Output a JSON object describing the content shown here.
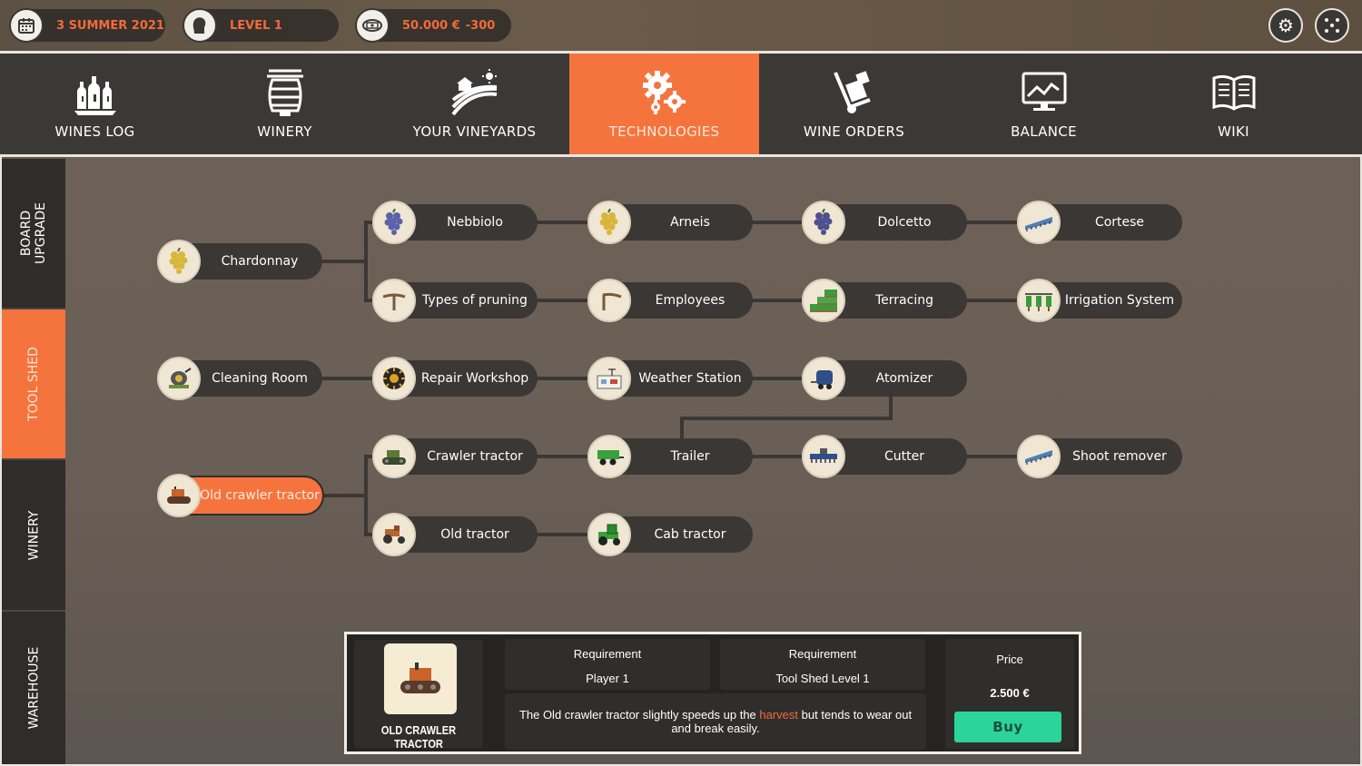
{
  "status_bar": {
    "date": "3 SUMMER 2021",
    "level": "LEVEL 1",
    "money": "50.000 €",
    "money_change": "-300",
    "icons": [
      "calendar-icon",
      "head-icon",
      "money-icon",
      "settings-icon",
      "fullscreen-icon"
    ]
  },
  "nav": {
    "items": [
      {
        "label": "WINES LOG",
        "icon": "bottles-icon"
      },
      {
        "label": "WINERY",
        "icon": "barrel-icon"
      },
      {
        "label": "YOUR VINEYARDS",
        "icon": "vineyard-icon"
      },
      {
        "label": "TECHNOLOGIES",
        "icon": "gears-icon",
        "active": true
      },
      {
        "label": "WINE ORDERS",
        "icon": "handtruck-icon"
      },
      {
        "label": "BALANCE",
        "icon": "monitor-chart-icon"
      },
      {
        "label": "WIKI",
        "icon": "book-icon"
      }
    ]
  },
  "side_tabs": [
    {
      "label_line1": "BOARD",
      "label_line2": "UPGRADE"
    },
    {
      "label_line1": "TOOL SHED",
      "label_line2": "",
      "active": true
    },
    {
      "label_line1": "WINERY",
      "label_line2": ""
    },
    {
      "label_line1": "WAREHOUSE",
      "label_line2": ""
    }
  ],
  "tree": {
    "nodes": {
      "chardonnay": {
        "label": "Chardonnay",
        "icon": "grape-white-icon"
      },
      "nebbiolo": {
        "label": "Nebbiolo",
        "icon": "grape-red-icon"
      },
      "arneis": {
        "label": "Arneis",
        "icon": "grape-white-icon"
      },
      "dolcetto": {
        "label": "Dolcetto",
        "icon": "grape-red-icon"
      },
      "cortese": {
        "label": "Cortese",
        "icon": "sprayer-icon"
      },
      "pruning": {
        "label": "Types of pruning",
        "icon": "pruning-icon"
      },
      "employees": {
        "label": "Employees",
        "icon": "pruning-icon"
      },
      "terracing": {
        "label": "Terracing",
        "icon": "terrace-icon"
      },
      "irrigation": {
        "label": "Irrigation System",
        "icon": "irrigation-icon"
      },
      "cleaning": {
        "label": "Cleaning Room",
        "icon": "cleaning-icon"
      },
      "repair": {
        "label": "Repair Workshop",
        "icon": "wheel-icon"
      },
      "weather": {
        "label": "Weather Station",
        "icon": "weather-station-icon"
      },
      "atomizer": {
        "label": "Atomizer",
        "icon": "atomizer-icon"
      },
      "crawler": {
        "label": "Crawler tractor",
        "icon": "crawler-icon"
      },
      "trailer": {
        "label": "Trailer",
        "icon": "trailer-icon"
      },
      "cutter": {
        "label": "Cutter",
        "icon": "cutter-icon"
      },
      "shoot": {
        "label": "Shoot remover",
        "icon": "sprayer-icon"
      },
      "oldcrawler": {
        "label": "Old crawler tractor",
        "icon": "old-crawler-icon",
        "selected": true
      },
      "oldtractor": {
        "label": "Old tractor",
        "icon": "tractor-icon"
      },
      "cabtractor": {
        "label": "Cab tractor",
        "icon": "cab-tractor-icon"
      }
    }
  },
  "detail": {
    "name": "OLD CRAWLER TRACTOR",
    "requirement1_title": "Requirement",
    "requirement1_value": "Player 1",
    "requirement2_title": "Requirement",
    "requirement2_value": "Tool Shed Level 1",
    "desc_before": "The Old crawler tractor slightly speeds up the ",
    "desc_highlight": "harvest",
    "desc_after": " but tends to wear out and break easily.",
    "price_label": "Price",
    "price_value": "2.500 €",
    "buy_label": "Buy"
  },
  "colors": {
    "accent": "#f5743e",
    "panel": "#3a3735",
    "buy": "#2bd49a",
    "highlight": "#f26a3a"
  }
}
